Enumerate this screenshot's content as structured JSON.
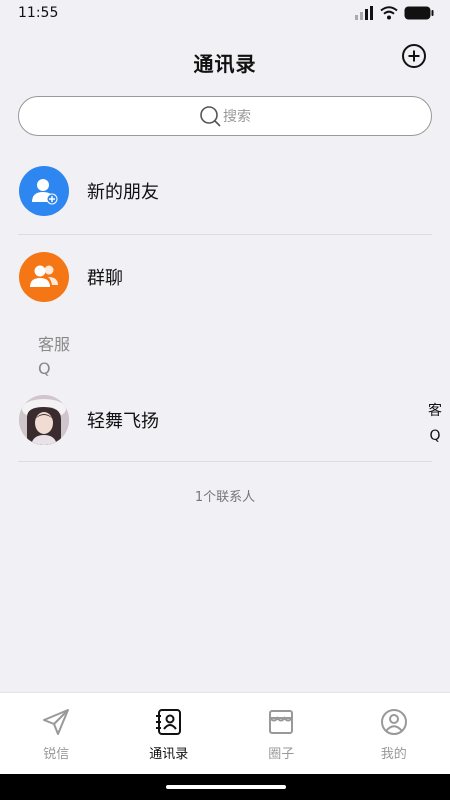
{
  "status_bar": {
    "time": "11:55"
  },
  "header": {
    "title": "通讯录"
  },
  "search": {
    "placeholder": "搜索"
  },
  "rows": {
    "new_friends": "新的朋友",
    "group_chat": "群聊"
  },
  "sections": [
    {
      "letter": "客服"
    },
    {
      "letter": "Q"
    }
  ],
  "contacts": [
    {
      "name": "轻舞飞扬"
    }
  ],
  "index_bar": [
    "客",
    "Q"
  ],
  "contact_count": "1个联系人",
  "tabs": [
    {
      "label": "锐信",
      "icon": "send-icon"
    },
    {
      "label": "通讯录",
      "icon": "contacts-icon",
      "active": true
    },
    {
      "label": "圈子",
      "icon": "store-icon"
    },
    {
      "label": "我的",
      "icon": "profile-icon"
    }
  ],
  "colors": {
    "new_friends_bg": "#2e86f0",
    "group_chat_bg": "#f57614",
    "background": "#f1f0f5"
  }
}
